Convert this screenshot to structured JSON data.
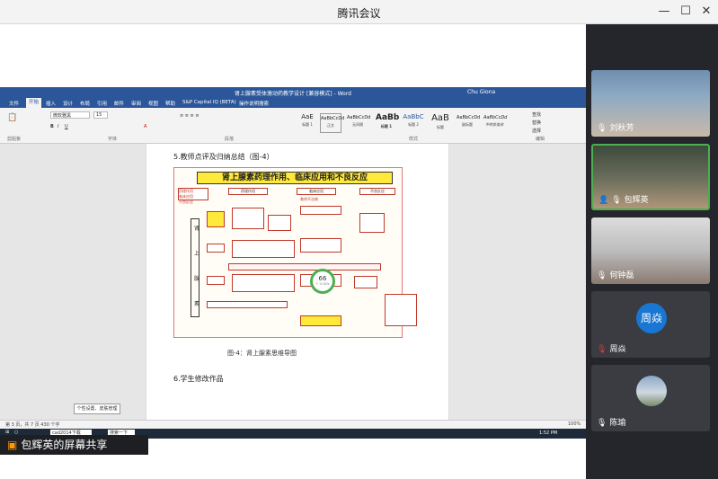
{
  "window": {
    "title": "腾讯会议",
    "controls": [
      "—",
      "☐",
      "✕"
    ]
  },
  "word": {
    "title": "肾上腺素受体激动药教学设计 [兼容模式] - Word",
    "user": "Chu Giona",
    "menu": [
      "文件",
      "开始",
      "插入",
      "设计",
      "布局",
      "引用",
      "邮件",
      "审阅",
      "视图",
      "帮助",
      "S&P Capital IQ (BETA)",
      "操作说明搜索"
    ],
    "active_menu": "开始",
    "ribbon": {
      "font_name": "微软雅黑",
      "font_size": "15",
      "groups": [
        "剪贴板",
        "字体",
        "段落",
        "样式",
        "编辑"
      ],
      "styles": [
        {
          "preview": "AaE",
          "label": "标题 1"
        },
        {
          "preview": "AaBbCcDd",
          "label": "正文"
        },
        {
          "preview": "AaBbCcDd",
          "label": "无间隔"
        },
        {
          "preview": "AaBb",
          "label": "标题 1"
        },
        {
          "preview": "AaBbC",
          "label": "标题 2"
        },
        {
          "preview": "AaB",
          "label": "标题"
        },
        {
          "preview": "AaBbCcDd",
          "label": "副标题"
        },
        {
          "preview": "AaBbCcDd",
          "label": "不明显强调"
        }
      ],
      "edit_items": [
        "查找",
        "替换",
        "选择"
      ]
    },
    "doc": {
      "heading": "5.教师点评及归纳总结（图-4）",
      "figure_title": "肾上腺素药理作用、临床应用和不良反应",
      "figure_labels": [
        "药理作用",
        "临床应用",
        "不良反应",
        "肾",
        "上",
        "腺",
        "素",
        "救命不治病"
      ],
      "caption": "图-4：肾上腺素思维导图",
      "heading2": "6.学生修改作品",
      "badge_value": "66",
      "badge_sub": "↑ 0.1K/s"
    },
    "status": "第 3 页，共 7 页    430 个字",
    "zoom": "100%",
    "tooltip": "个性设置、皮肤管理"
  },
  "taskbar": {
    "search": "搜索一下",
    "app": "cad2014下载",
    "time": "1:52 PM"
  },
  "share_label": "包辉英的屏幕共享",
  "participants": [
    {
      "name": "刘秋芳",
      "type": "photo",
      "active": false
    },
    {
      "name": "包辉英",
      "type": "photo",
      "active": true
    },
    {
      "name": "何钟磊",
      "type": "photo",
      "active": false
    },
    {
      "name": "周焱",
      "type": "avatar",
      "avatar": "周焱",
      "active": false
    },
    {
      "name": "陈瑜",
      "type": "photo",
      "active": false
    }
  ],
  "colors": {
    "accent": "#4caf50",
    "word_blue": "#2b579a",
    "avatar_blue": "#1976d2"
  }
}
